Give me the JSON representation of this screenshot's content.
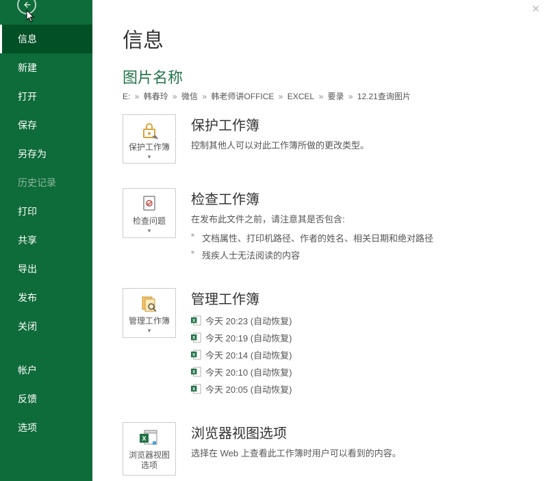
{
  "sidebar": {
    "items": [
      {
        "label": "信息",
        "key": "info",
        "active": true,
        "disabled": false
      },
      {
        "label": "新建",
        "key": "new",
        "active": false,
        "disabled": false
      },
      {
        "label": "打开",
        "key": "open",
        "active": false,
        "disabled": false
      },
      {
        "label": "保存",
        "key": "save",
        "active": false,
        "disabled": false
      },
      {
        "label": "另存为",
        "key": "saveas",
        "active": false,
        "disabled": false
      },
      {
        "label": "历史记录",
        "key": "history",
        "active": false,
        "disabled": true
      },
      {
        "label": "打印",
        "key": "print",
        "active": false,
        "disabled": false
      },
      {
        "label": "共享",
        "key": "share",
        "active": false,
        "disabled": false
      },
      {
        "label": "导出",
        "key": "export",
        "active": false,
        "disabled": false
      },
      {
        "label": "发布",
        "key": "publish",
        "active": false,
        "disabled": false
      },
      {
        "label": "关闭",
        "key": "close",
        "active": false,
        "disabled": false
      },
      {
        "label": "帐户",
        "key": "account",
        "active": false,
        "disabled": false,
        "group": true
      },
      {
        "label": "反馈",
        "key": "feedback",
        "active": false,
        "disabled": false
      },
      {
        "label": "选项",
        "key": "options",
        "active": false,
        "disabled": false
      }
    ]
  },
  "page": {
    "title": "信息",
    "doc_name": "图片名称",
    "breadcrumb": [
      "E:",
      "韩春玲",
      "微信",
      "韩老师讲OFFICE",
      "EXCEL",
      "要录",
      "12.21查询图片"
    ]
  },
  "protect": {
    "tile_label": "保护工作簿",
    "title": "保护工作簿",
    "desc": "控制其他人可以对此工作簿所做的更改类型。"
  },
  "inspect": {
    "tile_label": "检查问题",
    "title": "检查工作簿",
    "desc": "在发布此文件之前，请注意其是否包含:",
    "bullets": [
      "文档属性、打印机路径、作者的姓名、相关日期和绝对路径",
      "残疾人士无法阅读的内容"
    ]
  },
  "manage": {
    "tile_label": "管理工作簿",
    "title": "管理工作簿",
    "items": [
      "今天 20:23 (自动恢复)",
      "今天 20:19 (自动恢复)",
      "今天 20:14 (自动恢复)",
      "今天 20:10 (自动恢复)",
      "今天 20:05 (自动恢复)"
    ]
  },
  "browser": {
    "tile_label": "浏览器视图选项",
    "title": "浏览器视图选项",
    "desc": "选择在 Web 上查看此工作簿时用户可以看到的内容。"
  },
  "colors": {
    "brand": "#0e6b3a",
    "brand_dark": "#025025",
    "accent": "#217346"
  }
}
